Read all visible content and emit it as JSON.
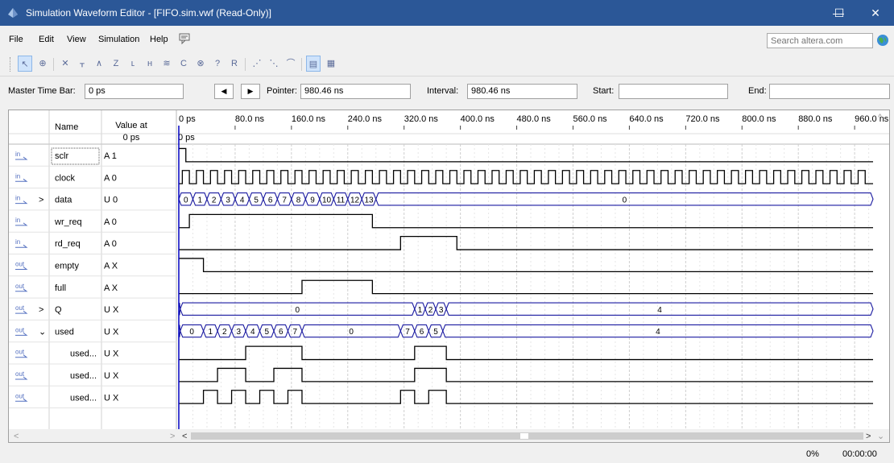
{
  "window": {
    "title": "Simulation Waveform Editor - [FIFO.sim.vwf (Read-Only)]",
    "minimize": "—",
    "maximize": "☐",
    "close": "✕"
  },
  "menu": [
    "File",
    "Edit",
    "View",
    "Simulation",
    "Help"
  ],
  "search": {
    "placeholder": "Search altera.com"
  },
  "timebar": {
    "master_label": "Master Time Bar:",
    "master_value": "0 ps",
    "pointer_label": "Pointer:",
    "pointer_value": "980.46 ns",
    "interval_label": "Interval:",
    "interval_value": "980.46 ns",
    "start_label": "Start:",
    "start_value": "",
    "end_label": "End:",
    "end_value": ""
  },
  "grid": {
    "col_name": "Name",
    "col_value_line1": "Value at",
    "col_value_line2": "0 ps",
    "cursor_label": "0 ps",
    "time_ticks": [
      "0 ps",
      "80.0 ns",
      "160.0 ns",
      "240.0 ns",
      "320.0 ns",
      "400.0 ns",
      "480.0 ns",
      "560.0 ns",
      "640.0 ns",
      "720.0 ns",
      "800.0 ns",
      "880.0 ns",
      "960.0 ns"
    ],
    "signals": [
      {
        "dir": "in",
        "expand": "",
        "name": "sclr",
        "value": "A 1",
        "indent": false
      },
      {
        "dir": "in",
        "expand": "",
        "name": "clock",
        "value": "A 0",
        "indent": false
      },
      {
        "dir": "in",
        "expand": ">",
        "name": "data",
        "value": "U 0",
        "indent": false
      },
      {
        "dir": "in",
        "expand": "",
        "name": "wr_req",
        "value": "A 0",
        "indent": false
      },
      {
        "dir": "in",
        "expand": "",
        "name": "rd_req",
        "value": "A 0",
        "indent": false
      },
      {
        "dir": "out",
        "expand": "",
        "name": "empty",
        "value": "A X",
        "indent": false
      },
      {
        "dir": "out",
        "expand": "",
        "name": "full",
        "value": "A X",
        "indent": false
      },
      {
        "dir": "out",
        "expand": ">",
        "name": "Q",
        "value": "U X",
        "indent": false
      },
      {
        "dir": "out",
        "expand": "v",
        "name": "used",
        "value": "U X",
        "indent": false
      },
      {
        "dir": "out",
        "expand": "",
        "name": "used...",
        "value": "U X",
        "indent": true
      },
      {
        "dir": "out",
        "expand": "",
        "name": "used...",
        "value": "U X",
        "indent": true
      },
      {
        "dir": "out",
        "expand": "",
        "name": "used...",
        "value": "U X",
        "indent": true
      }
    ],
    "bus_labels": {
      "data": [
        "0",
        "1",
        "2",
        "3",
        "4",
        "5",
        "6",
        "7",
        "8",
        "9",
        "10",
        "11",
        "12",
        "13",
        "0"
      ],
      "Q": [
        "0",
        "1",
        "2",
        "3",
        "4"
      ],
      "used": [
        "0",
        "1",
        "2",
        "3",
        "4",
        "5",
        "6",
        "7",
        "0",
        "7",
        "6",
        "5",
        "4"
      ]
    }
  },
  "status": {
    "percent": "0%",
    "time": "00:00:00"
  },
  "colors": {
    "titlebar": "#2b5797",
    "bus": "#1a1aa0",
    "wave": "#000000",
    "cursor": "#0000c0"
  }
}
